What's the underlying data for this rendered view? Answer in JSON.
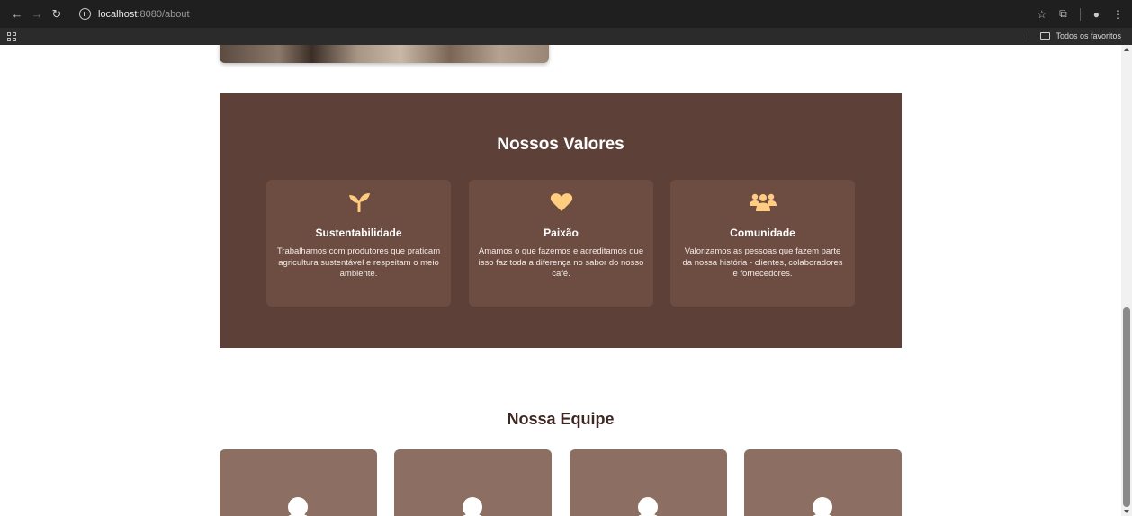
{
  "browser": {
    "url_host": "localhost",
    "url_path": ":8080/about",
    "bookmarks_folder": "Todos os favoritos"
  },
  "values_section": {
    "title": "Nossos Valores",
    "background": "#5d4037",
    "card_background": "#6d4c41",
    "icon_color": "#ffcc80",
    "cards": [
      {
        "icon": "seedling-icon",
        "title": "Sustentabilidade",
        "text": "Trabalhamos com produtores que praticam agricultura sustentável e respeitam o meio ambiente."
      },
      {
        "icon": "heart-icon",
        "title": "Paixão",
        "text": "Amamos o que fazemos e acreditamos que isso faz toda a diferença no sabor do nosso café."
      },
      {
        "icon": "users-icon",
        "title": "Comunidade",
        "text": "Valorizamos as pessoas que fazem parte da nossa história - clientes, colaboradores e fornecedores."
      }
    ]
  },
  "team_section": {
    "title": "Nossa Equipe",
    "card_background": "#8d6e63",
    "members": [
      {
        "icon": "user-icon"
      },
      {
        "icon": "user-icon"
      },
      {
        "icon": "user-icon"
      },
      {
        "icon": "user-icon"
      }
    ]
  }
}
